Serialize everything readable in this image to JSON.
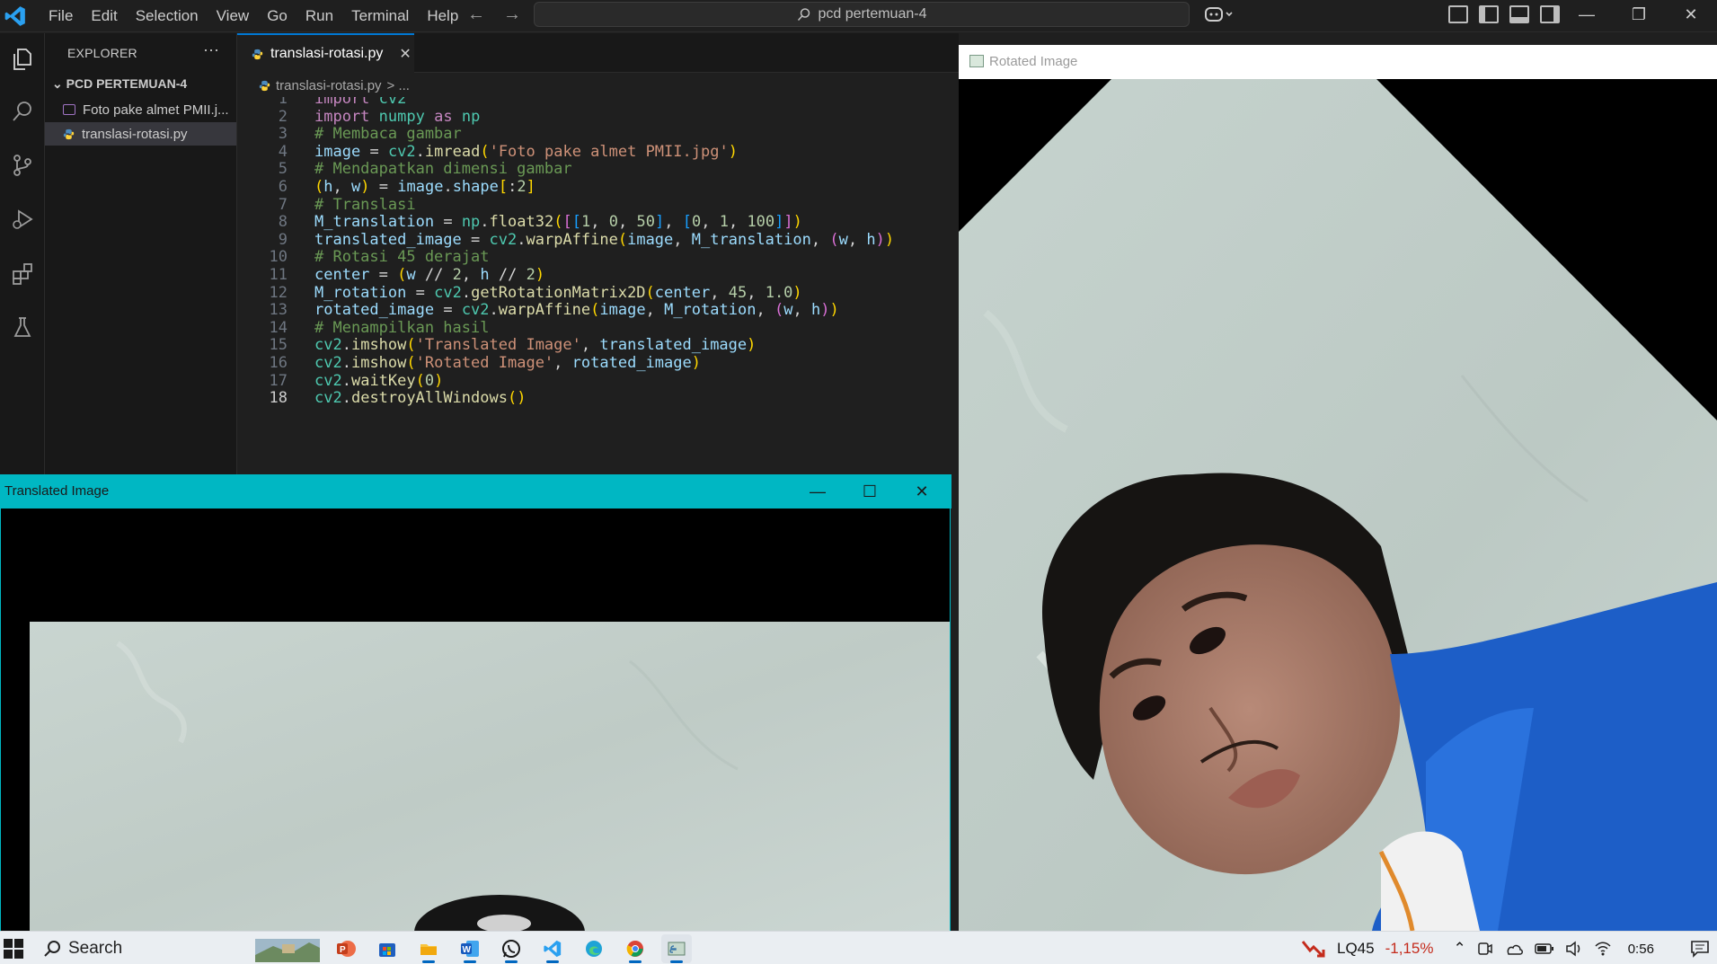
{
  "menu": [
    "File",
    "Edit",
    "Selection",
    "View",
    "Go",
    "Run",
    "Terminal",
    "Help"
  ],
  "search": {
    "text": "pcd pertemuan-4"
  },
  "explorer": {
    "header": "EXPLORER",
    "more": "···",
    "folder": "PCD PERTEMUAN-4",
    "files": [
      {
        "name": "Foto pake almet PMII.j...",
        "type": "image"
      },
      {
        "name": "translasi-rotasi.py",
        "type": "python"
      }
    ]
  },
  "editor": {
    "tab_label": "translasi-rotasi.py",
    "breadcrumb_file": "translasi-rotasi.py",
    "breadcrumb_rest": "> ...",
    "current_line": 18,
    "lines": [
      {
        "n": "1",
        "text": "import cv2"
      },
      {
        "n": "2",
        "text": "import numpy as np"
      },
      {
        "n": "3",
        "text": "# Membaca gambar"
      },
      {
        "n": "4",
        "text": "image = cv2.imread('Foto pake almet PMII.jpg')"
      },
      {
        "n": "5",
        "text": "# Mendapatkan dimensi gambar"
      },
      {
        "n": "6",
        "text": "(h, w) = image.shape[:2]"
      },
      {
        "n": "7",
        "text": "# Translasi"
      },
      {
        "n": "8",
        "text": "M_translation = np.float32([[1, 0, 50], [0, 1, 100]])"
      },
      {
        "n": "9",
        "text": "translated_image = cv2.warpAffine(image, M_translation, (w, h))"
      },
      {
        "n": "10",
        "text": "# Rotasi 45 derajat"
      },
      {
        "n": "11",
        "text": "center = (w // 2, h // 2)"
      },
      {
        "n": "12",
        "text": "M_rotation = cv2.getRotationMatrix2D(center, 45, 1.0)"
      },
      {
        "n": "13",
        "text": "rotated_image = cv2.warpAffine(image, M_rotation, (w, h))"
      },
      {
        "n": "14",
        "text": "# Menampilkan hasil"
      },
      {
        "n": "15",
        "text": "cv2.imshow('Translated Image', translated_image)"
      },
      {
        "n": "16",
        "text": "cv2.imshow('Rotated Image', rotated_image)"
      },
      {
        "n": "17",
        "text": "cv2.waitKey(0)"
      },
      {
        "n": "18",
        "text": "cv2.destroyAllWindows()"
      }
    ]
  },
  "translated_window": {
    "title": "Translated Image",
    "minimize": "—",
    "maximize": "☐",
    "close": "✕",
    "accent": "#00b7c3"
  },
  "rotated_window": {
    "title": "Rotated Image"
  },
  "taskbar": {
    "search_label": "Search",
    "stock_name": "LQ45",
    "stock_change": "-1,15%",
    "clock": "0:56",
    "apps": [
      "picture-thumbnail",
      "powerpoint-icon",
      "store-icon",
      "file-explorer-icon",
      "word-icon",
      "whatsapp-icon",
      "vscode-icon",
      "edge-icon",
      "chrome-icon",
      "python-window-icon"
    ]
  },
  "colors": {
    "vscode_blue": "#0078d4",
    "editor_bg": "#1f1f1f",
    "taskbar_bg": "#eaeef2"
  }
}
